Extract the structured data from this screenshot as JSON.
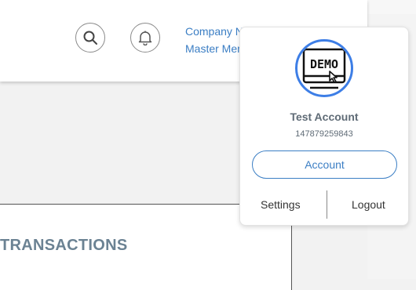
{
  "header": {
    "search_icon": "search-icon",
    "bell_icon": "bell-icon",
    "company_name": "Company N",
    "account_type": "Master Men"
  },
  "content": {
    "section_title": "TRANSACTIONS"
  },
  "account_menu": {
    "avatar_text": "DEMO",
    "avatar_icon": "demo-monitor-icon",
    "account_name": "Test Account",
    "account_id": "147879259843",
    "account_button": "Account",
    "settings_link": "Settings",
    "logout_link": "Logout"
  },
  "colors": {
    "accent": "#3b7ec4",
    "avatar_ring": "#3d7ee6",
    "title": "#6b8293"
  }
}
